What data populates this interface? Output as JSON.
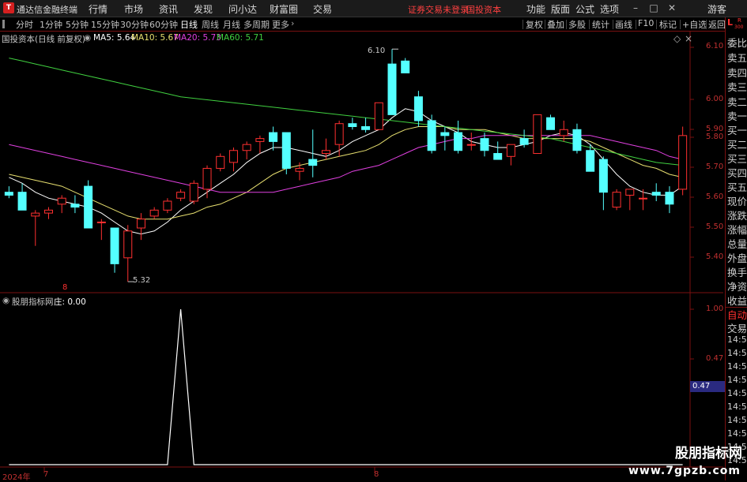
{
  "menubar": {
    "logo": "T",
    "app_title": "通达信金融终端",
    "items": [
      "行情",
      "市场",
      "资讯",
      "发现",
      "问小达",
      "财富圈",
      "交易"
    ],
    "status_text": "证券交易未登录",
    "stock_text": "国投资本",
    "right_items": [
      "功能",
      "版面",
      "公式",
      "选项"
    ],
    "user": "游客"
  },
  "toolbar": {
    "periods": [
      "分时",
      "1分钟",
      "5分钟",
      "15分钟",
      "30分钟",
      "60分钟",
      "日线",
      "周线",
      "月线",
      "多周期",
      "更多"
    ],
    "active_period": "日线",
    "actions": [
      "复权",
      "叠加",
      "多股",
      "统计",
      "画线",
      "F10",
      "标记",
      "+自选",
      "返回"
    ]
  },
  "main_chart": {
    "title": "国投资本(日线 前复权)",
    "ma": [
      {
        "label": "MA5:",
        "value": "5.64",
        "color": "#ffffff"
      },
      {
        "label": "MA10:",
        "value": "5.67",
        "color": "#e8e070"
      },
      {
        "label": "MA20:",
        "value": "5.73",
        "color": "#e040e0"
      },
      {
        "label": "MA60:",
        "value": "5.71",
        "color": "#40d040"
      }
    ],
    "high_label": "6.10",
    "low_label": "5.32",
    "month_marker": "8",
    "y_ticks": [
      "6.10",
      "6.00",
      "5.90",
      "5.80",
      "5.70",
      "5.60",
      "5.50",
      "5.40"
    ]
  },
  "chart_data": [
    {
      "type": "candlestick",
      "title": "国投资本(日线 前复权)",
      "up_color": "#ff3030",
      "down_color": "#54ffff",
      "ylim": [
        5.32,
        6.12
      ],
      "series": [
        {
          "name": "K",
          "ohlc": [
            [
              5.62,
              5.64,
              5.6,
              5.61
            ],
            [
              5.62,
              5.65,
              5.59,
              5.56
            ],
            [
              5.54,
              5.56,
              5.44,
              5.55
            ],
            [
              5.55,
              5.57,
              5.53,
              5.56
            ],
            [
              5.58,
              5.61,
              5.55,
              5.6
            ],
            [
              5.58,
              5.61,
              5.55,
              5.57
            ],
            [
              5.64,
              5.66,
              5.5,
              5.5
            ],
            [
              5.52,
              5.53,
              5.46,
              5.52
            ],
            [
              5.5,
              5.5,
              5.35,
              5.38
            ],
            [
              5.4,
              5.51,
              5.32,
              5.49
            ],
            [
              5.5,
              5.55,
              5.46,
              5.53
            ],
            [
              5.54,
              5.57,
              5.53,
              5.56
            ],
            [
              5.56,
              5.6,
              5.55,
              5.59
            ],
            [
              5.6,
              5.63,
              5.59,
              5.62
            ],
            [
              5.59,
              5.66,
              5.58,
              5.65
            ],
            [
              5.63,
              5.71,
              5.6,
              5.7
            ],
            [
              5.7,
              5.75,
              5.69,
              5.74
            ],
            [
              5.72,
              5.77,
              5.69,
              5.76
            ],
            [
              5.76,
              5.79,
              5.73,
              5.78
            ],
            [
              5.79,
              5.81,
              5.75,
              5.8
            ],
            [
              5.82,
              5.84,
              5.76,
              5.79
            ],
            [
              5.82,
              5.82,
              5.68,
              5.7
            ],
            [
              5.69,
              5.72,
              5.66,
              5.7
            ],
            [
              5.73,
              5.83,
              5.67,
              5.71
            ],
            [
              5.75,
              5.8,
              5.73,
              5.76
            ],
            [
              5.78,
              5.86,
              5.74,
              5.85
            ],
            [
              5.85,
              5.87,
              5.83,
              5.84
            ],
            [
              5.84,
              5.87,
              5.82,
              5.83
            ],
            [
              5.83,
              5.92,
              5.83,
              5.92
            ],
            [
              6.05,
              6.1,
              5.88,
              5.88
            ],
            [
              6.06,
              6.07,
              6.02,
              6.02
            ],
            [
              5.94,
              5.96,
              5.84,
              5.86
            ],
            [
              5.86,
              5.88,
              5.75,
              5.76
            ],
            [
              5.82,
              5.84,
              5.76,
              5.81
            ],
            [
              5.82,
              5.86,
              5.75,
              5.76
            ],
            [
              5.78,
              5.82,
              5.76,
              5.78
            ],
            [
              5.8,
              5.82,
              5.74,
              5.76
            ],
            [
              5.75,
              5.79,
              5.73,
              5.73
            ],
            [
              5.74,
              5.78,
              5.71,
              5.78
            ],
            [
              5.8,
              5.83,
              5.77,
              5.78
            ],
            [
              5.75,
              5.88,
              5.75,
              5.88
            ],
            [
              5.87,
              5.88,
              5.83,
              5.83
            ],
            [
              5.81,
              5.86,
              5.79,
              5.83
            ],
            [
              5.83,
              5.85,
              5.75,
              5.76
            ],
            [
              5.76,
              5.78,
              5.69,
              5.69
            ],
            [
              5.73,
              5.74,
              5.56,
              5.62
            ],
            [
              5.57,
              5.63,
              5.56,
              5.62
            ],
            [
              5.61,
              5.63,
              5.56,
              5.63
            ],
            [
              5.6,
              5.63,
              5.56,
              5.6
            ],
            [
              5.62,
              5.65,
              5.59,
              5.61
            ],
            [
              5.62,
              5.64,
              5.55,
              5.58
            ],
            [
              5.63,
              5.84,
              5.61,
              5.81
            ]
          ]
        },
        {
          "name": "MA5",
          "color": "#ffffff",
          "values": [
            5.67,
            5.65,
            5.62,
            5.6,
            5.59,
            5.58,
            5.57,
            5.55,
            5.52,
            5.49,
            5.48,
            5.49,
            5.52,
            5.56,
            5.59,
            5.62,
            5.65,
            5.68,
            5.72,
            5.75,
            5.77,
            5.77,
            5.76,
            5.75,
            5.74,
            5.76,
            5.79,
            5.81,
            5.83,
            5.87,
            5.9,
            5.89,
            5.86,
            5.84,
            5.82,
            5.79,
            5.78,
            5.77,
            5.77,
            5.78,
            5.79,
            5.81,
            5.82,
            5.81,
            5.78,
            5.73,
            5.68,
            5.64,
            5.62,
            5.61,
            5.61,
            5.64
          ]
        },
        {
          "name": "MA10",
          "color": "#e8e070",
          "values": [
            5.68,
            5.67,
            5.66,
            5.65,
            5.64,
            5.62,
            5.6,
            5.58,
            5.56,
            5.54,
            5.53,
            5.53,
            5.53,
            5.54,
            5.55,
            5.57,
            5.58,
            5.6,
            5.62,
            5.65,
            5.68,
            5.7,
            5.71,
            5.72,
            5.73,
            5.74,
            5.75,
            5.76,
            5.78,
            5.81,
            5.83,
            5.84,
            5.84,
            5.84,
            5.83,
            5.83,
            5.83,
            5.82,
            5.81,
            5.8,
            5.8,
            5.8,
            5.8,
            5.8,
            5.79,
            5.77,
            5.75,
            5.73,
            5.71,
            5.7,
            5.68,
            5.67
          ]
        },
        {
          "name": "MA20",
          "color": "#e040e0",
          "values": [
            5.78,
            5.77,
            5.76,
            5.75,
            5.74,
            5.73,
            5.72,
            5.71,
            5.7,
            5.69,
            5.68,
            5.67,
            5.66,
            5.65,
            5.64,
            5.63,
            5.62,
            5.62,
            5.62,
            5.62,
            5.62,
            5.63,
            5.64,
            5.65,
            5.66,
            5.67,
            5.69,
            5.7,
            5.71,
            5.73,
            5.75,
            5.77,
            5.78,
            5.79,
            5.8,
            5.8,
            5.81,
            5.81,
            5.81,
            5.81,
            5.81,
            5.81,
            5.81,
            5.81,
            5.81,
            5.8,
            5.79,
            5.78,
            5.77,
            5.76,
            5.74,
            5.73
          ]
        },
        {
          "name": "MA60",
          "color": "#40d040",
          "values": [
            6.07,
            6.06,
            6.05,
            6.04,
            6.03,
            6.02,
            6.01,
            6.0,
            5.99,
            5.98,
            5.97,
            5.96,
            5.95,
            5.94,
            5.935,
            5.93,
            5.925,
            5.92,
            5.915,
            5.91,
            5.905,
            5.9,
            5.895,
            5.89,
            5.885,
            5.88,
            5.875,
            5.87,
            5.865,
            5.86,
            5.855,
            5.85,
            5.845,
            5.84,
            5.835,
            5.83,
            5.825,
            5.82,
            5.815,
            5.81,
            5.805,
            5.8,
            5.79,
            5.78,
            5.77,
            5.76,
            5.75,
            5.74,
            5.73,
            5.72,
            5.715,
            5.71
          ]
        }
      ]
    },
    {
      "type": "line",
      "title": "股朋指标网",
      "ylim": [
        0,
        1.05
      ],
      "series": [
        {
          "name": "庄",
          "color": "#ffffff",
          "values": [
            0,
            0,
            0,
            0,
            0,
            0,
            0,
            0,
            0,
            0,
            0,
            0,
            0,
            1,
            0,
            0,
            0,
            0,
            0,
            0,
            0,
            0,
            0,
            0,
            0,
            0,
            0,
            0,
            0,
            0,
            0,
            0,
            0,
            0,
            0,
            0,
            0,
            0,
            0,
            0,
            0,
            0,
            0,
            0,
            0,
            0,
            0,
            0,
            0,
            0,
            0,
            0
          ]
        }
      ]
    }
  ],
  "indicator": {
    "title": "股朋指标网",
    "series_label": "庄:",
    "series_value": "0.00",
    "y_ticks": [
      "1.00",
      "0.47"
    ],
    "cursor_value": "0.47"
  },
  "x_axis": {
    "year_label": "2024年",
    "month_label_1": "7",
    "month_label_2": "8"
  },
  "right_panel": {
    "corner": "L",
    "corner_r": "R",
    "corner_num": "300",
    "labels": [
      "委比",
      "卖五",
      "卖四",
      "卖三",
      "卖二",
      "卖一",
      "买一",
      "买二",
      "买三",
      "买四",
      "买五",
      "现价",
      "涨跌",
      "涨幅",
      "总量",
      "外盘",
      "换手",
      "净资",
      "收益"
    ],
    "auto_label": "自动",
    "trade_label": "交易",
    "times": [
      "14:56",
      "14:56",
      "14:56",
      "14:56",
      "14:56",
      "14:56",
      "14:56",
      "14:56",
      "14:56",
      "14:56"
    ]
  },
  "watermark": {
    "line1": "股朋指标网",
    "line2": "www.7gpzb.com"
  }
}
